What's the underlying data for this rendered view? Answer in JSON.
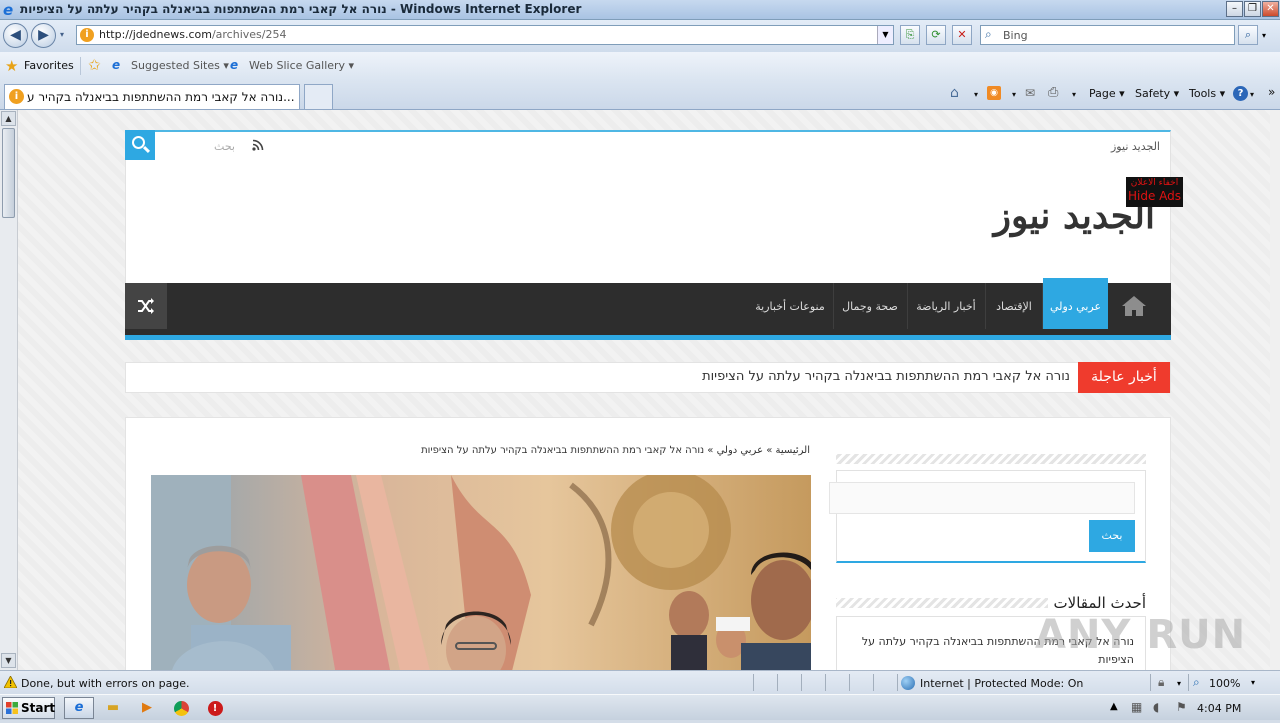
{
  "window": {
    "title": "נורה אל קאבי רמת ההשתתפות בביאנלה בקהיר עלתה על הציפיות - Windows Internet Explorer"
  },
  "address_bar": {
    "url_host": "http://jdednews.com",
    "url_path": "/archives/254",
    "search_placeholder": "Bing"
  },
  "favorites_bar": {
    "favorites_label": "Favorites",
    "items": [
      "Suggested Sites ▾",
      "Web Slice Gallery ▾"
    ]
  },
  "tab": {
    "label": "נורה אל קאבי רמת ההשתתפות בביאנלה בקהיר ע..."
  },
  "command_bar": {
    "page": "Page ▾",
    "safety": "Safety ▾",
    "tools": "Tools ▾",
    "help": "▾"
  },
  "site": {
    "name_small": "الجديد نيوز",
    "logo": "الجديد نيوز",
    "search_placeholder": "بحث",
    "hide_ads_ar": "اخفاء الاعلان",
    "hide_ads_en": "Hide Ads",
    "nav": [
      {
        "label": "عربي دولي",
        "active": true
      },
      {
        "label": "الإقتصاد",
        "active": false
      },
      {
        "label": "أخبار الرياضة",
        "active": false
      },
      {
        "label": "صحة وجمال",
        "active": false
      },
      {
        "label": "منوعات أخبارية",
        "active": false
      }
    ],
    "breaking_label": "أخبار عاجلة",
    "breaking_text": "נורה אל קאבי רמת ההשתתפות בביאנלה בקהיר עלתה על הציפיות",
    "breadcrumb": {
      "home": "الرئيسية",
      "sep": "»",
      "category": "عربي دولي",
      "current": "נורה אל קאבי רמת ההשתתפות בביאנלה בקהיר עלתה על הציפיות"
    },
    "sidebar": {
      "search_button": "بحث",
      "recent_title": "أحدث المقالات",
      "recent_item": "נורה אל קאבי רמת ההשתתפות בביאנלה בקהיר עלתה על הציפיות"
    },
    "watermark": "ANY RUN"
  },
  "status_bar": {
    "text": "Done, but with errors on page.",
    "zone": "Internet | Protected Mode: On",
    "zoom": "100%"
  },
  "taskbar": {
    "start": "Start",
    "clock": "4:04 PM"
  }
}
